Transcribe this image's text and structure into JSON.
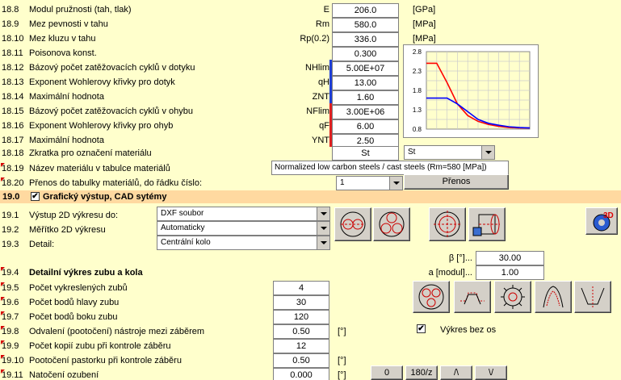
{
  "rows18": [
    {
      "num": "18.8",
      "label": "Modul pružnosti (tah, tlak)",
      "sym": "E",
      "val": "206.0",
      "unit": "[GPa]"
    },
    {
      "num": "18.9",
      "label": "Mez pevnosti v tahu",
      "sym": "Rm",
      "val": "580.0",
      "unit": "[MPa]"
    },
    {
      "num": "18.10",
      "label": "Mez kluzu v tahu",
      "sym": "Rp(0.2)",
      "val": "336.0",
      "unit": "[MPa]"
    },
    {
      "num": "18.11",
      "label": "Poisonova konst.",
      "sym": "",
      "val": "0.300",
      "unit": ""
    },
    {
      "num": "18.12",
      "label": "Bázový počet zatěžovacích cyklů v dotyku",
      "sym": "NHlim",
      "val": "5.00E+07",
      "unit": ""
    },
    {
      "num": "18.13",
      "label": "Exponent Wohlerovy křivky pro dotyk",
      "sym": "qH",
      "val": "13.00",
      "unit": ""
    },
    {
      "num": "18.14",
      "label": "Maximální hodnota",
      "sym": "ZNT",
      "val": "1.60",
      "unit": ""
    },
    {
      "num": "18.15",
      "label": "Bázový počet zatěžovacích cyklů v ohybu",
      "sym": "NFlim",
      "val": "3.00E+06",
      "unit": ""
    },
    {
      "num": "18.16",
      "label": "Exponent Wohlerovy křivky pro ohyb",
      "sym": "qF",
      "val": "6.00",
      "unit": ""
    },
    {
      "num": "18.17",
      "label": "Maximální hodnota",
      "sym": "YNT",
      "val": "2.50",
      "unit": ""
    }
  ],
  "r1818": {
    "num": "18.18",
    "label": "Zkratka pro označení materiálu",
    "val": "St",
    "dropdown": "St"
  },
  "r1819": {
    "num": "18.19",
    "label": "Název materiálu v tabulce materiálů",
    "val": "Normalized low carbon steels / cast steels (Rm=580  [MPa])"
  },
  "r1820": {
    "num": "18.20",
    "label": "Přenos do tabulky materiálů, do řádku číslo:",
    "dropdown": "1",
    "button": "Přenos"
  },
  "sec19": {
    "num": "19.0",
    "title": "Grafický výstup, CAD sytémy",
    "checked": "✔"
  },
  "r191": {
    "num": "19.1",
    "label": "Výstup 2D výkresu do:",
    "value": "DXF soubor"
  },
  "r192": {
    "num": "19.2",
    "label": "Měřítko 2D výkresu",
    "value": "Automaticky"
  },
  "r193": {
    "num": "19.3",
    "label": "Detail:",
    "value": "Centrální kolo"
  },
  "beta": {
    "label": "β [°]...",
    "val": "30.00"
  },
  "amod": {
    "label": "a [modul]...",
    "val": "1.00"
  },
  "r194": {
    "num": "19.4",
    "label": "Detailní výkres zubu a kola"
  },
  "rows19": [
    {
      "num": "19.5",
      "label": "Počet vykreslených zubů",
      "val": "4",
      "unit": ""
    },
    {
      "num": "19.6",
      "label": "Počet bodů hlavy zubu",
      "val": "30",
      "unit": ""
    },
    {
      "num": "19.7",
      "label": "Počet bodů boku zubu",
      "val": "120",
      "unit": ""
    },
    {
      "num": "19.8",
      "label": "Odvalení (pootočení) nástroje mezi záběrem",
      "val": "0.50",
      "unit": "[°]"
    },
    {
      "num": "19.9",
      "label": "Počet kopií zubu při kontrole záběru",
      "val": "12",
      "unit": ""
    },
    {
      "num": "19.10",
      "label": "Pootočení pastorku při kontrole záběru",
      "val": "0.50",
      "unit": "[°]"
    },
    {
      "num": "19.11",
      "label": "Natočení ozubení",
      "val": "0.000",
      "unit": "[°]"
    }
  ],
  "noAxes": {
    "label": "Výkres bez os",
    "checked": "✔"
  },
  "rotButtons": [
    "0",
    "180/z",
    "/\\",
    "\\/"
  ],
  "chart_data": {
    "type": "line",
    "yticks": [
      "2.8",
      "2.3",
      "1.8",
      "1.3",
      "0.8"
    ],
    "ylim": [
      0.8,
      2.8
    ],
    "x": [
      0,
      1,
      2,
      3,
      4,
      5,
      6,
      7,
      8,
      9,
      10
    ],
    "series": [
      {
        "color": "#ff0000",
        "values": [
          2.5,
          2.5,
          2.0,
          1.45,
          1.15,
          1.0,
          0.92,
          0.87,
          0.84,
          0.83,
          0.83
        ]
      },
      {
        "color": "#0000ff",
        "values": [
          1.6,
          1.6,
          1.6,
          1.45,
          1.25,
          1.05,
          0.95,
          0.9,
          0.86,
          0.84,
          0.83
        ]
      }
    ],
    "grid": true
  }
}
